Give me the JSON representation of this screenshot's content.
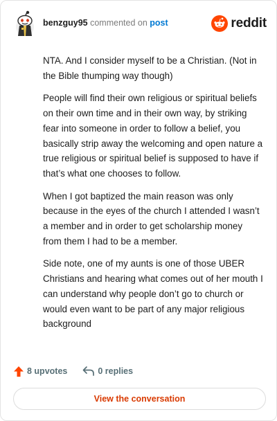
{
  "comment": {
    "username": "benzguy95",
    "action_text": "commented on",
    "post_link": "post",
    "paragraphs": [
      "NTA. And I consider myself to be a Christian. (Not in the Bible thumping way though)",
      "People will find their own religious or spiritual beliefs on their own time and in their own way, by striking fear into someone in order to follow a belief, you basically strip away the welcoming and open nature a true religious or spiritual belief is supposed to have if that’s what one chooses to follow.",
      "When I got baptized the main reason was only because in the eyes of the church I attended I wasn’t a member and in order to get scholarship money from them I had to be a member.",
      "Side note, one of my aunts is one of those UBER Christians and hearing what comes out of her mouth I can understand why people don’t go to church or would even want to be part of any major religious background"
    ]
  },
  "brand": {
    "name": "reddit",
    "color": "#ff4500",
    "icon": "reddit-logo-icon"
  },
  "actions": {
    "upvotes_label": "8 upvotes",
    "replies_label": "0 replies",
    "upvote_icon": "upvote-arrow-icon",
    "reply_icon": "reply-arrow-icon",
    "upvote_color": "#ff4500"
  },
  "cta": {
    "label": "View the conversation",
    "color": "#d93a00"
  }
}
